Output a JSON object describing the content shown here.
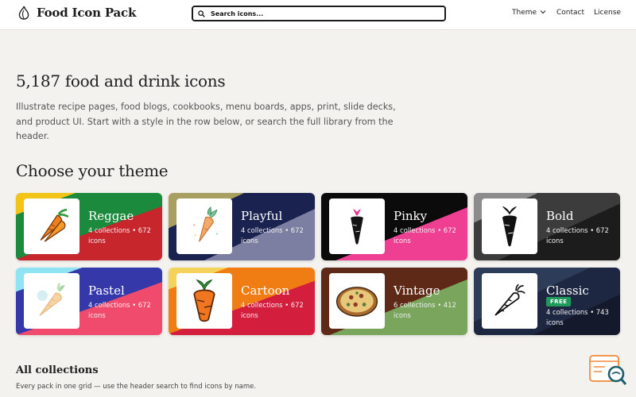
{
  "header": {
    "brand": "Food Icon Pack",
    "search_placeholder": "Search icons...",
    "nav": {
      "theme": "Theme",
      "contact": "Contact",
      "license": "License"
    }
  },
  "hero": {
    "title": "5,187 food and drink icons",
    "description": "Illustrate recipe pages, food blogs, cookbooks, menu boards, apps, print, slide decks, and product UI. Start with a style in the row below, or search the full library from the header."
  },
  "themes": {
    "heading": "Choose your theme",
    "items": [
      {
        "name": "Reggae",
        "meta": "4 collections • 672 icons",
        "icon": "carrot-reggae-icon"
      },
      {
        "name": "Playful",
        "meta": "4 collections • 672 icons",
        "icon": "carrot-playful-icon"
      },
      {
        "name": "Pinky",
        "meta": "4 collections • 672 icons",
        "icon": "carrot-pinky-icon"
      },
      {
        "name": "Bold",
        "meta": "4 collections • 672 icons",
        "icon": "carrot-bold-icon"
      },
      {
        "name": "Pastel",
        "meta": "4 collections • 672 icons",
        "icon": "carrot-pastel-icon"
      },
      {
        "name": "Cartoon",
        "meta": "4 collections • 672 icons",
        "icon": "carrot-cartoon-icon"
      },
      {
        "name": "Vintage",
        "meta": "6 collections • 412 icons",
        "icon": "pizza-vintage-icon"
      },
      {
        "name": "Classic",
        "badge": "FREE",
        "meta": "4 collections • 743 icons",
        "icon": "carrot-outline-icon"
      }
    ]
  },
  "collections": {
    "heading": "All collections",
    "subtitle": "Every pack in one grid — use the header search to find icons by name."
  },
  "colors": {
    "accent_free": "#1f9a5a",
    "page_bg": "#f4f2ee",
    "search_border": "#1b1b1b"
  }
}
